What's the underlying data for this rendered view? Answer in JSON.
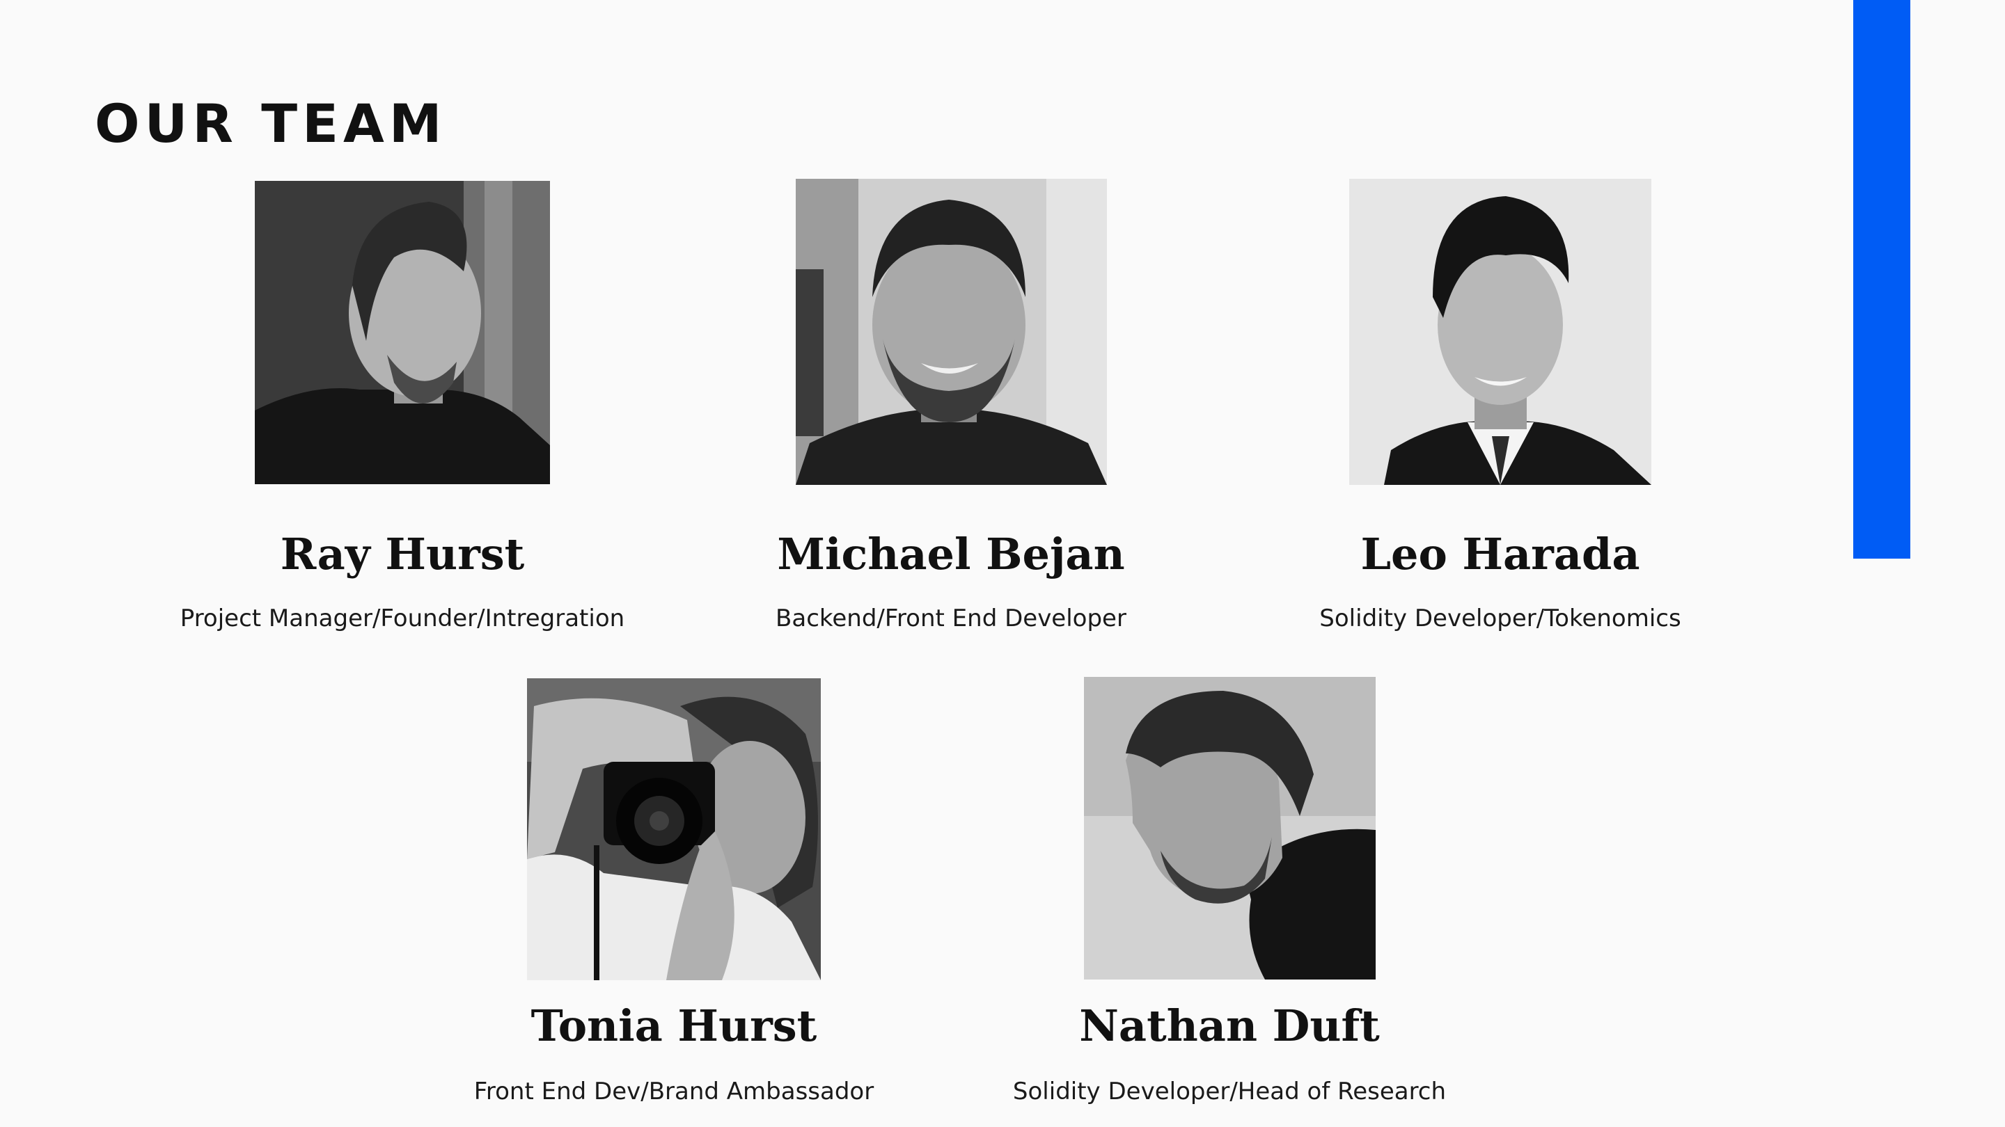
{
  "section_title": "OUR TEAM",
  "accent_color": "#005cf5",
  "members": [
    {
      "name": "Ray Hurst",
      "role": "Project Manager/Founder/Intregration"
    },
    {
      "name": "Michael Bejan",
      "role": "Backend/Front End Developer"
    },
    {
      "name": "Leo Harada",
      "role": "Solidity Developer/Tokenomics"
    },
    {
      "name": "Tonia Hurst",
      "role": "Front End Dev/Brand Ambassador"
    },
    {
      "name": "Nathan Duft",
      "role": "Solidity Developer/Head of Research"
    }
  ]
}
